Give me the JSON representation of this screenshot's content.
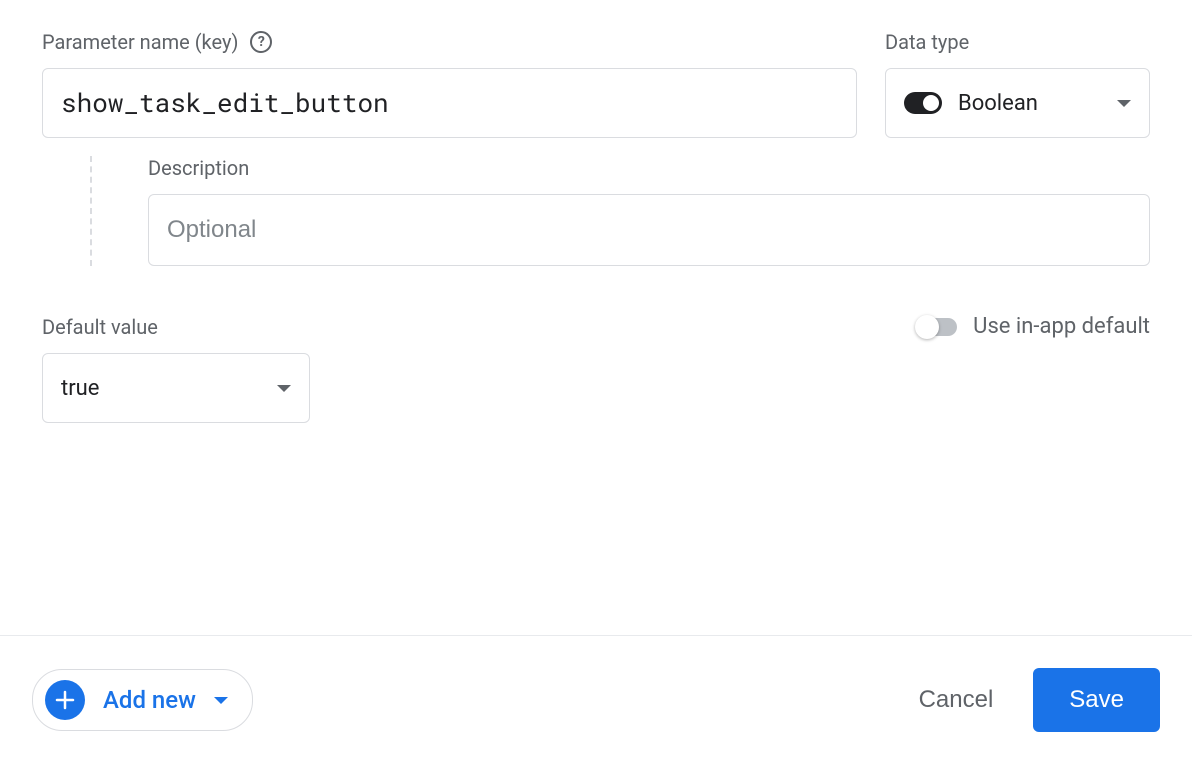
{
  "labels": {
    "parameter_name": "Parameter name (key)",
    "data_type": "Data type",
    "description": "Description",
    "default_value": "Default value",
    "use_inapp_default": "Use in-app default"
  },
  "fields": {
    "parameter_name_value": "show_task_edit_button",
    "data_type_value": "Boolean",
    "description_placeholder": "Optional",
    "description_value": "",
    "default_value": "true",
    "use_inapp_default_on": false
  },
  "footer": {
    "add_new": "Add new",
    "cancel": "Cancel",
    "save": "Save"
  }
}
